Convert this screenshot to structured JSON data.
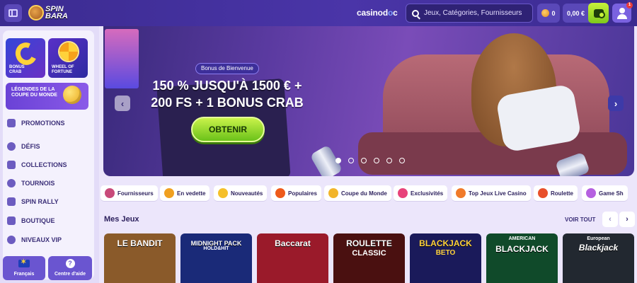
{
  "topbar": {
    "logo_line1": "SPIN",
    "logo_line2": "BARA",
    "partner_prefix": "casinod",
    "partner_mid": "o",
    "partner_suffix": "c",
    "search_placeholder": "Jeux, Catégories, Fournisseurs",
    "coins_value": "0",
    "balance_value": "0,00 €",
    "notification_count": "1"
  },
  "sidebar": {
    "promo_tiles": [
      {
        "label": "Bonus Crab"
      },
      {
        "label": "Wheel of Fortune"
      }
    ],
    "legend_tile": "Légendes de la Coupe du Monde",
    "nav_items": [
      {
        "label": "Promotions",
        "icon": "gift-icon"
      },
      {
        "label": "Défis",
        "icon": "target-icon"
      },
      {
        "label": "Collections",
        "icon": "collection-icon"
      },
      {
        "label": "Tournois",
        "icon": "trophy-icon"
      },
      {
        "label": "Spin Rally",
        "icon": "flag-icon"
      },
      {
        "label": "Boutique",
        "icon": "shop-icon"
      },
      {
        "label": "Niveaux VIP",
        "icon": "vip-icon"
      }
    ],
    "language_label": "Français",
    "help_label": "Centre d'aide"
  },
  "hero": {
    "pill": "Bonus de Bienvenue",
    "title_line1": "150 % JUSQU'À 1500 € +",
    "title_line2": "200 FS + 1 BONUS CRAB",
    "cta": "OBTENIR",
    "slides_total": 6,
    "active_slide": 1
  },
  "categories": [
    {
      "label": "Fournisseurs",
      "icon": "providers-icon",
      "color": "#c84a7a"
    },
    {
      "label": "En vedette",
      "icon": "featured-icon",
      "color": "#f0a020"
    },
    {
      "label": "Nouveautés",
      "icon": "new-icon",
      "color": "#f5c02a"
    },
    {
      "label": "Populaires",
      "icon": "fire-icon",
      "color": "#ee5a1a"
    },
    {
      "label": "Coupe du Monde",
      "icon": "football-icon",
      "color": "#f2b52a"
    },
    {
      "label": "Exclusivités",
      "icon": "diamond-icon",
      "color": "#e8437a"
    },
    {
      "label": "Top Jeux Live Casino",
      "icon": "star-icon",
      "color": "#f07a2a"
    },
    {
      "label": "Roulette",
      "icon": "roulette-icon",
      "color": "#e8502a"
    },
    {
      "label": "Game Sh",
      "icon": "game-show-icon",
      "color": "#b560e0"
    }
  ],
  "mes_jeux": {
    "title": "Mes Jeux",
    "see_all": "VOIR TOUT",
    "games": [
      {
        "title": "LE BANDIT",
        "subtitle": "",
        "bg": "#8a5a2a"
      },
      {
        "title": "MIDNIGHT PACK",
        "subtitle": "HOLD&HIT",
        "bg": "#1a2a78"
      },
      {
        "title": "Baccarat",
        "subtitle": "",
        "bg": "#9a1a2a"
      },
      {
        "title": "ROULETTE",
        "subtitle": "CLASSIC",
        "bg": "#4a1010"
      },
      {
        "title": "BLACKJACK",
        "subtitle": "BETO",
        "bg": "#1a1a5a"
      },
      {
        "title": "BLACKJACK",
        "subtitle": "AMERICAN",
        "bg": "#104a2a"
      },
      {
        "title": "Blackjack",
        "subtitle": "European",
        "bg": "#222830"
      }
    ]
  }
}
